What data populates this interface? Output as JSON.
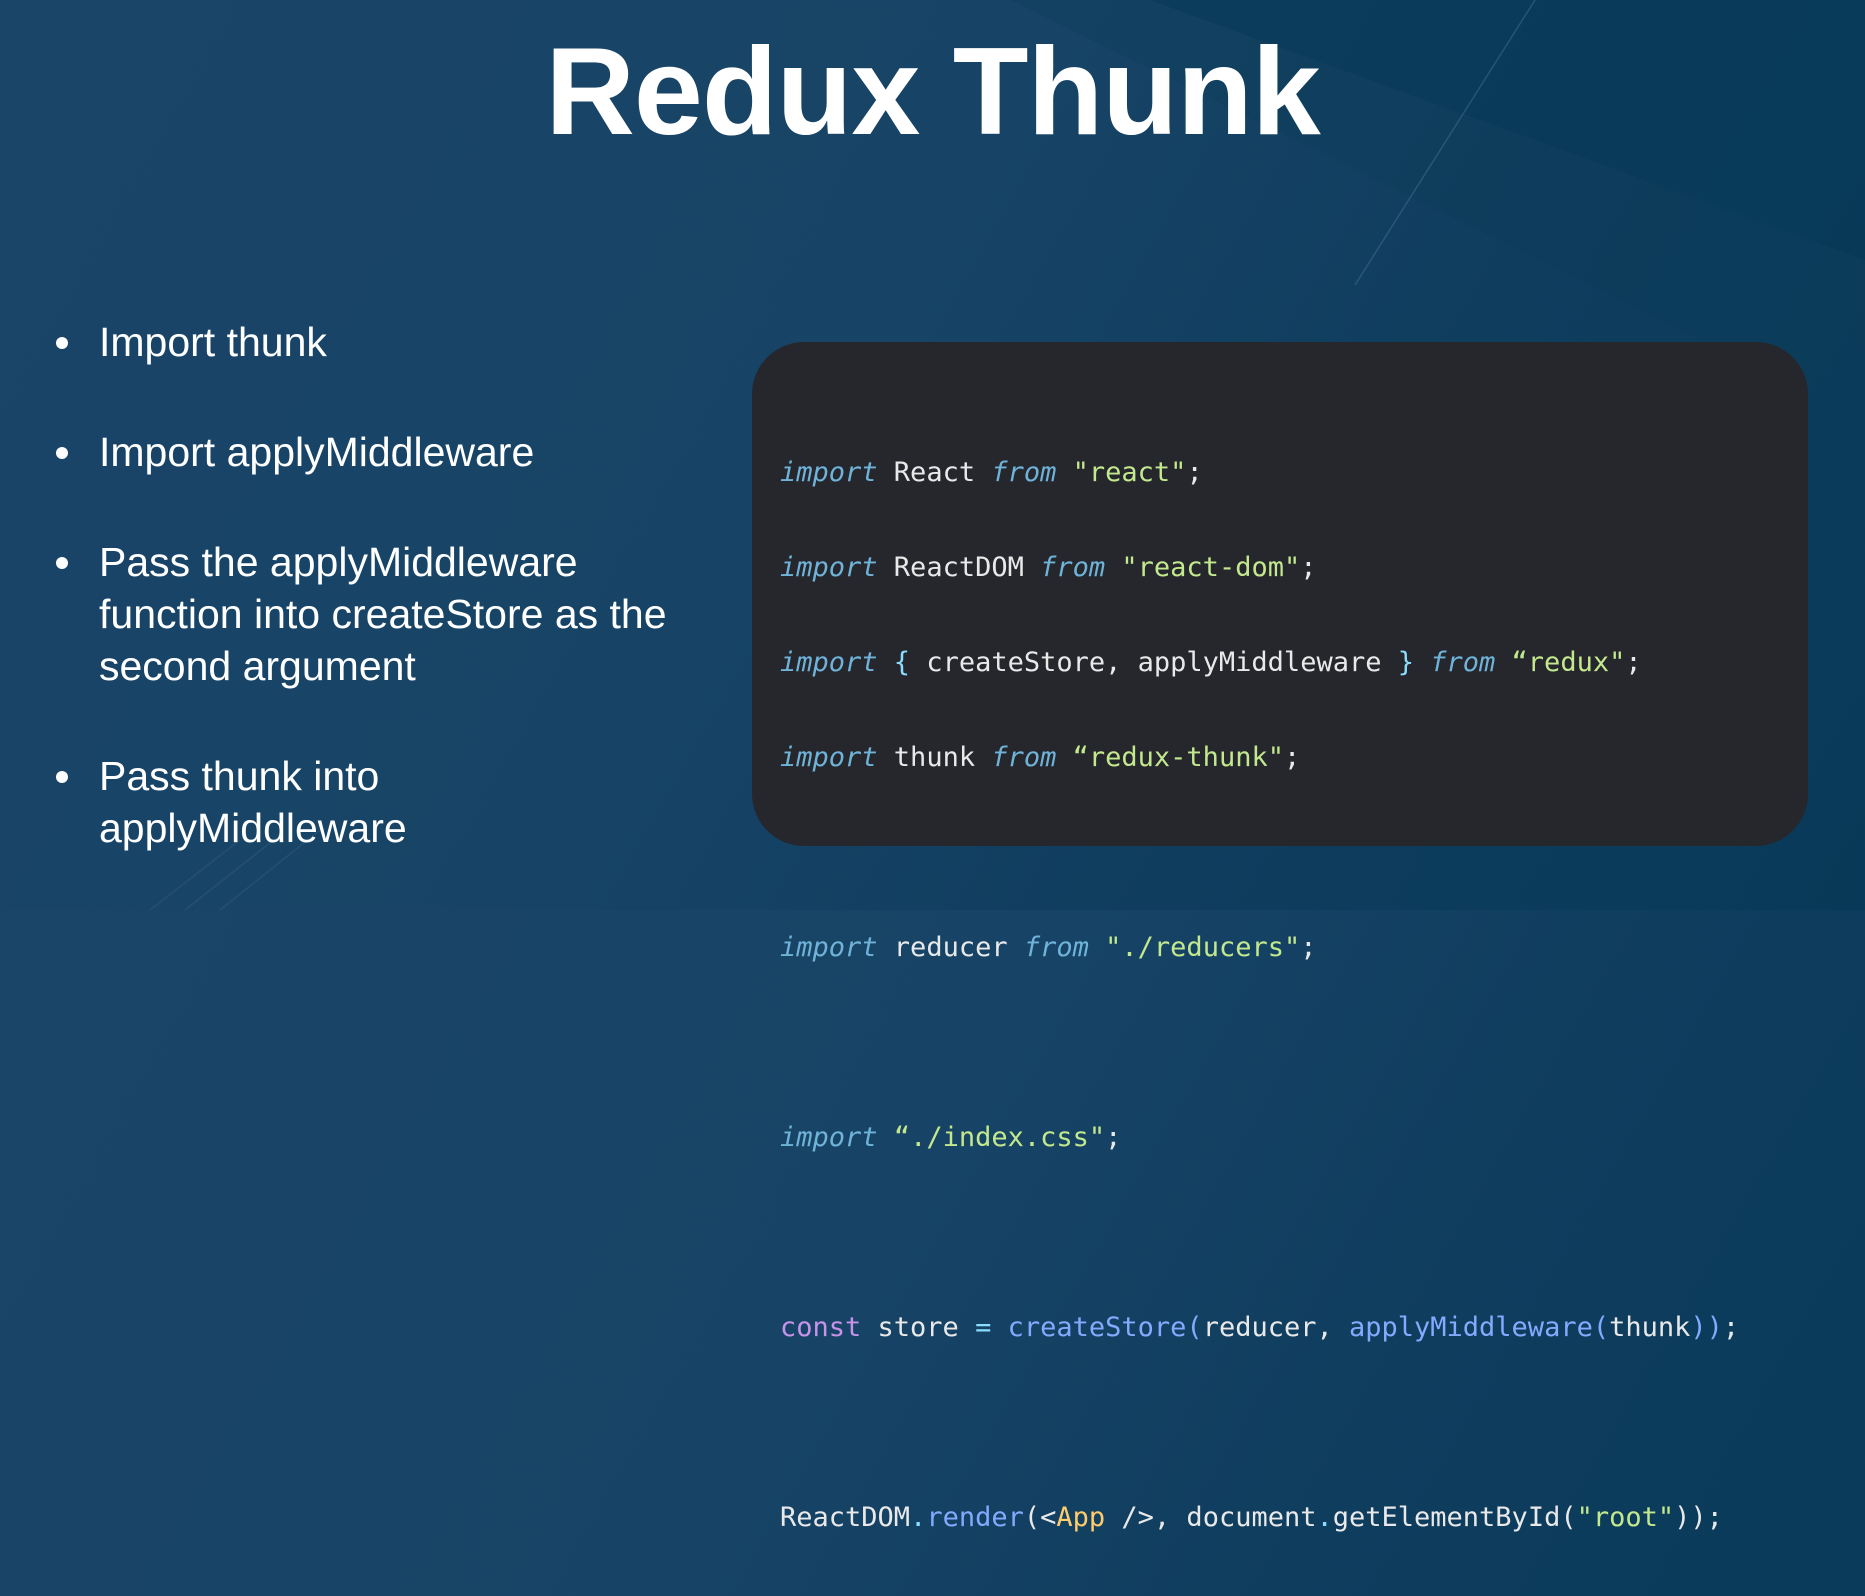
{
  "slide": {
    "title": "Redux Thunk"
  },
  "bullets": [
    {
      "text": "Import thunk"
    },
    {
      "text": "Import applyMiddleware"
    },
    {
      "text": "Pass the applyMiddleware function into createStore as the second argument"
    },
    {
      "text": "Pass thunk into applyMiddleware"
    }
  ],
  "code": {
    "l1": {
      "kw": "import",
      "t1": " React ",
      "kw2": "from",
      "t2": " ",
      "str": "\"react\"",
      "end": ";"
    },
    "l2": {
      "kw": "import",
      "t1": " ReactDOM ",
      "kw2": "from",
      "t2": " ",
      "str": "\"react-dom\"",
      "end": ";"
    },
    "l3": {
      "kw": "import",
      "b1": " {",
      "t1": " createStore, applyMiddleware ",
      "b2": "}",
      "kw2": " from",
      "t2": " ",
      "str": "“redux\"",
      "end": ";"
    },
    "l4": {
      "kw": "import",
      "t1": " thunk ",
      "kw2": "from",
      "t2": " ",
      "str": "“redux-thunk\"",
      "end": ";"
    },
    "l5": {
      "kw": "import",
      "t1": " reducer ",
      "kw2": "from",
      "t2": " ",
      "str": "\"./reducers\"",
      "end": ";"
    },
    "l6": {
      "kw": "import",
      "t1": " ",
      "str": "“./index.css\"",
      "end": ";"
    },
    "l7": {
      "const": "const",
      "t1": " store ",
      "op": "=",
      "t2": " ",
      "fn": "createStore",
      "p1": "(",
      "t3": "reducer, ",
      "fn2": "applyMiddleware",
      "p2": "(",
      "t4": "thunk",
      "p3": "))",
      "end": ";"
    },
    "l8": {
      "t1": "ReactDOM",
      "dot1": ".",
      "fn": "render",
      "t2": "(<",
      "tag": "App",
      "t3": " />, document",
      "dot2": ".",
      "t4": "getElementById(",
      "str": "\"root\"",
      "t5": "));"
    }
  },
  "colors": {
    "background": "#174466",
    "code_background": "#25272d",
    "keyword": "#6fb3d9",
    "string": "#c3e88d",
    "const": "#c792ea",
    "function": "#82aaff",
    "jsx_tag": "#ffcb6b"
  }
}
